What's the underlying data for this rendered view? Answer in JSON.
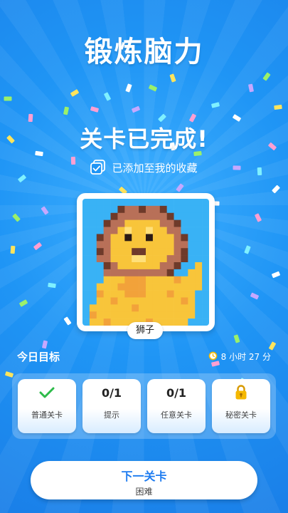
{
  "header": {
    "title": "锻炼脑力"
  },
  "result": {
    "heading": "关卡已完成!",
    "collection_note": "已添加至我的收藏"
  },
  "artwork": {
    "label": "狮子"
  },
  "daily_goal": {
    "title": "今日目标",
    "timer": "8 小时 27 分",
    "tasks": [
      {
        "icon": "check-icon",
        "value": "",
        "label": "普通关卡"
      },
      {
        "icon": "",
        "value": "0/1",
        "label": "提示"
      },
      {
        "icon": "",
        "value": "0/1",
        "label": "任意关卡"
      },
      {
        "icon": "lock-icon",
        "value": "",
        "label": "秘密关卡"
      }
    ]
  },
  "next_button": {
    "label": "下一关卡",
    "difficulty": "困难"
  },
  "colors": {
    "background": "#1e8ef5",
    "accent_blue": "#1e7cf0",
    "check_green": "#2dbb4a",
    "lock_gold": "#f5b800"
  }
}
